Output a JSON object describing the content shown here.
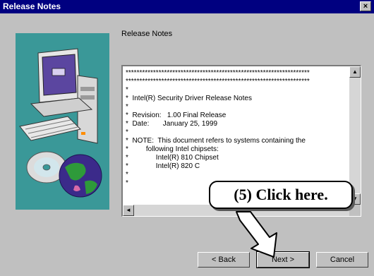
{
  "window": {
    "title": "Release Notes",
    "close_glyph": "×"
  },
  "page": {
    "heading": "Release Notes"
  },
  "notes": {
    "lines": [
      "*******************************************************************",
      "*******************************************************************",
      "*",
      "*  Intel(R) Security Driver Release Notes",
      "*",
      "*  Revision:   1.00 Final Release",
      "*  Date:       January 25, 1999",
      "*",
      "*  NOTE:  This document refers to systems containing the",
      "*         following Intel chipsets:",
      "*              Intel(R) 810 Chipset",
      "*              Intel(R) 820 C",
      "*",
      "*"
    ]
  },
  "scrollbar": {
    "up_glyph": "▲",
    "down_glyph": "▼",
    "left_glyph": "◄"
  },
  "buttons": {
    "back": "< Back",
    "next": "Next >",
    "cancel": "Cancel"
  },
  "callout": {
    "text": "(5)  Click here."
  }
}
